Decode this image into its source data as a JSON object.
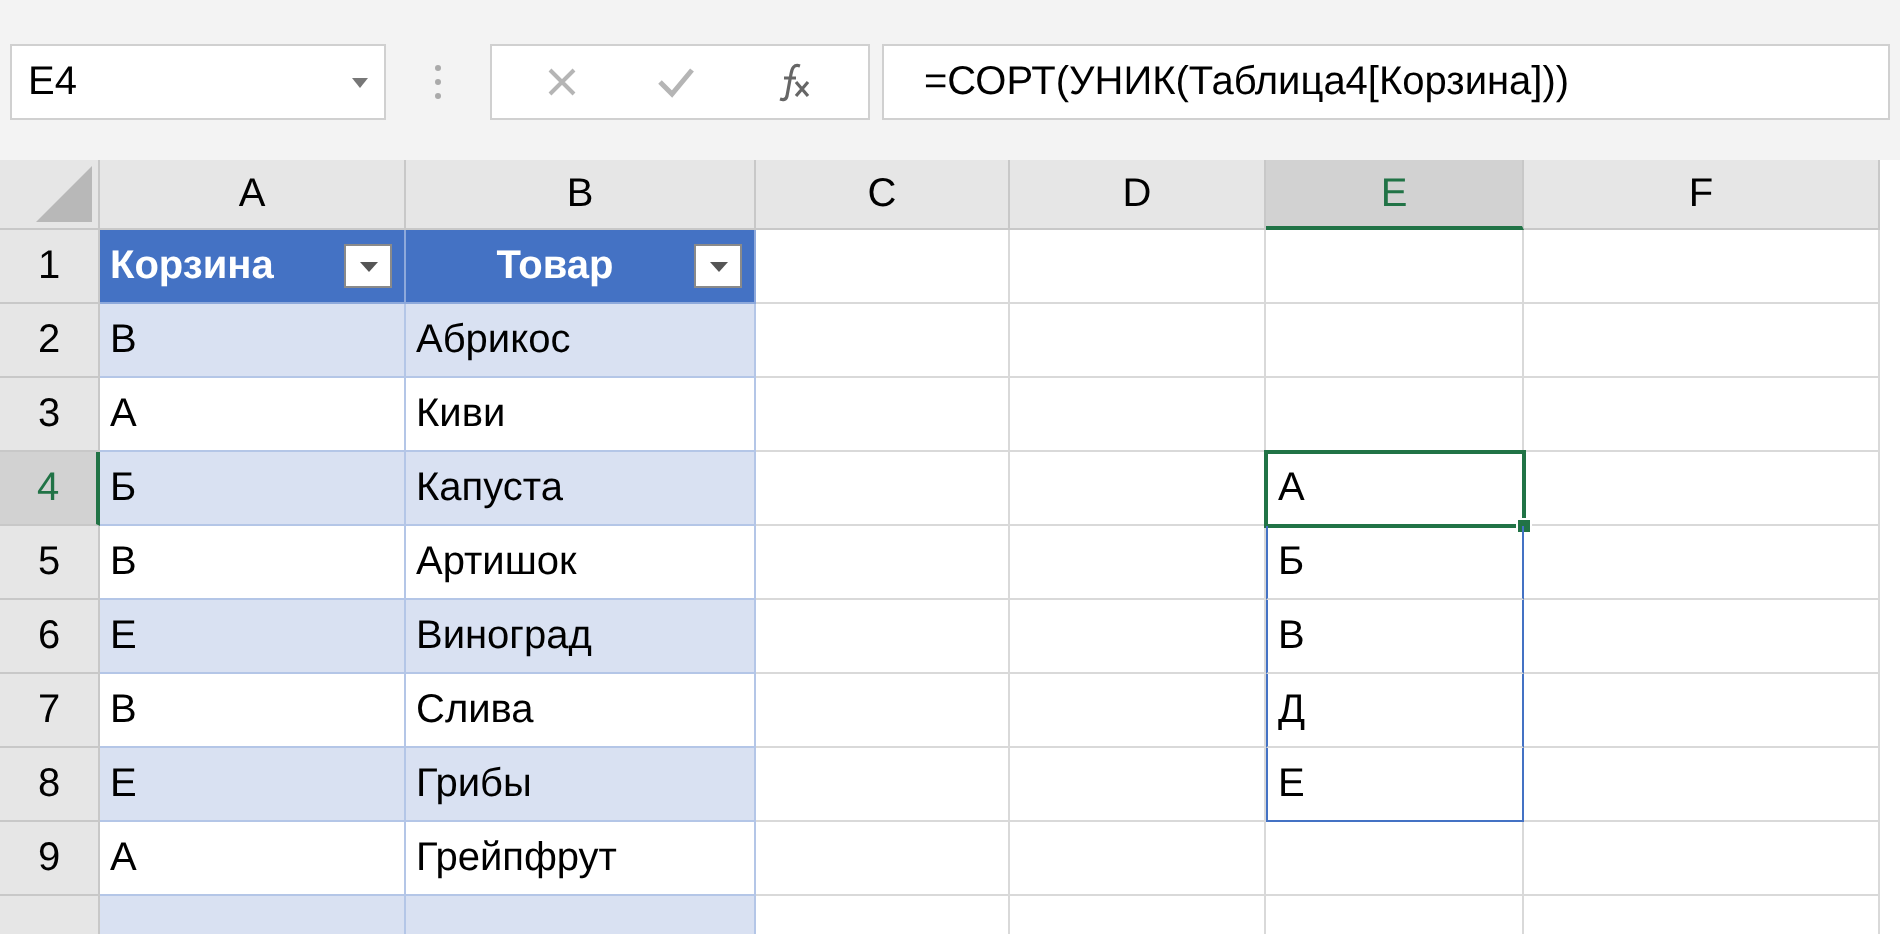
{
  "name_box": {
    "value": "E4"
  },
  "formula_bar": {
    "value": "=СОРТ(УНИК(Таблица4[Корзина]))"
  },
  "columns": [
    {
      "label": "A",
      "selected": false
    },
    {
      "label": "B",
      "selected": false
    },
    {
      "label": "C",
      "selected": false
    },
    {
      "label": "D",
      "selected": false
    },
    {
      "label": "E",
      "selected": true
    },
    {
      "label": "F",
      "selected": false
    }
  ],
  "rows": [
    {
      "label": "1",
      "selected": false
    },
    {
      "label": "2",
      "selected": false
    },
    {
      "label": "3",
      "selected": false
    },
    {
      "label": "4",
      "selected": true
    },
    {
      "label": "5",
      "selected": false
    },
    {
      "label": "6",
      "selected": false
    },
    {
      "label": "7",
      "selected": false
    },
    {
      "label": "8",
      "selected": false
    },
    {
      "label": "9",
      "selected": false
    }
  ],
  "table": {
    "columns": [
      "Корзина",
      "Товар"
    ],
    "rows": [
      [
        "В",
        "Абрикос"
      ],
      [
        "А",
        "Киви"
      ],
      [
        "Б",
        "Капуста"
      ],
      [
        "В",
        "Артишок"
      ],
      [
        "Е",
        "Виноград"
      ],
      [
        "В",
        "Слива"
      ],
      [
        "Е",
        "Грибы"
      ],
      [
        "А",
        "Грейпфрут"
      ]
    ]
  },
  "spill": {
    "values": [
      "А",
      "Б",
      "В",
      "Д",
      "Е"
    ]
  }
}
